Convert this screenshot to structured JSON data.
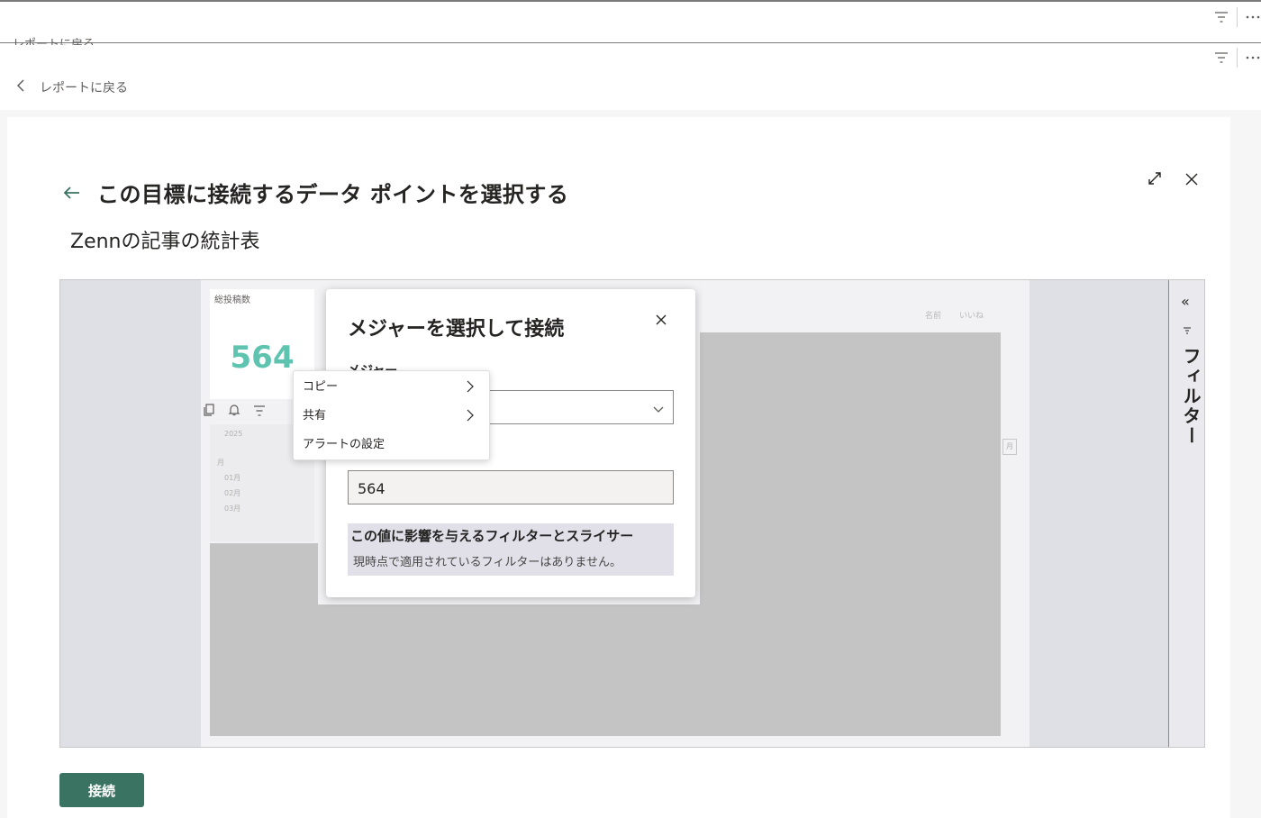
{
  "top_chrome": {
    "ghost_label": "レポートに戻る"
  },
  "nav": {
    "back_label": "レポートに戻る"
  },
  "panel": {
    "title": "この目標に接続するデータ ポイントを選択する",
    "subtitle": "Zennの記事の統計表"
  },
  "report": {
    "card_label": "総投稿数",
    "card_value": "564",
    "slicer_header": "2025",
    "slicer_title": "月",
    "slicer_items": [
      "01月",
      "02月",
      "03月"
    ],
    "table_headers": [
      "名前",
      "いいね"
    ],
    "month_tag": "月"
  },
  "filter_pane": {
    "label": "フィルター"
  },
  "context_menu": {
    "items": [
      "コピー",
      "共有",
      "アラートの設定"
    ]
  },
  "dialog": {
    "title": "メジャーを選択して接続",
    "field_label": "メジャー",
    "selected_measure": "",
    "value": "564",
    "info_heading": "この値に影響を与えるフィルターとスライサー",
    "info_text": "現時点で適用されているフィルターはありません。"
  },
  "actions": {
    "connect_label": "接続"
  },
  "colors": {
    "accent_green": "#3a7361",
    "card_value": "#5ec4b0"
  }
}
